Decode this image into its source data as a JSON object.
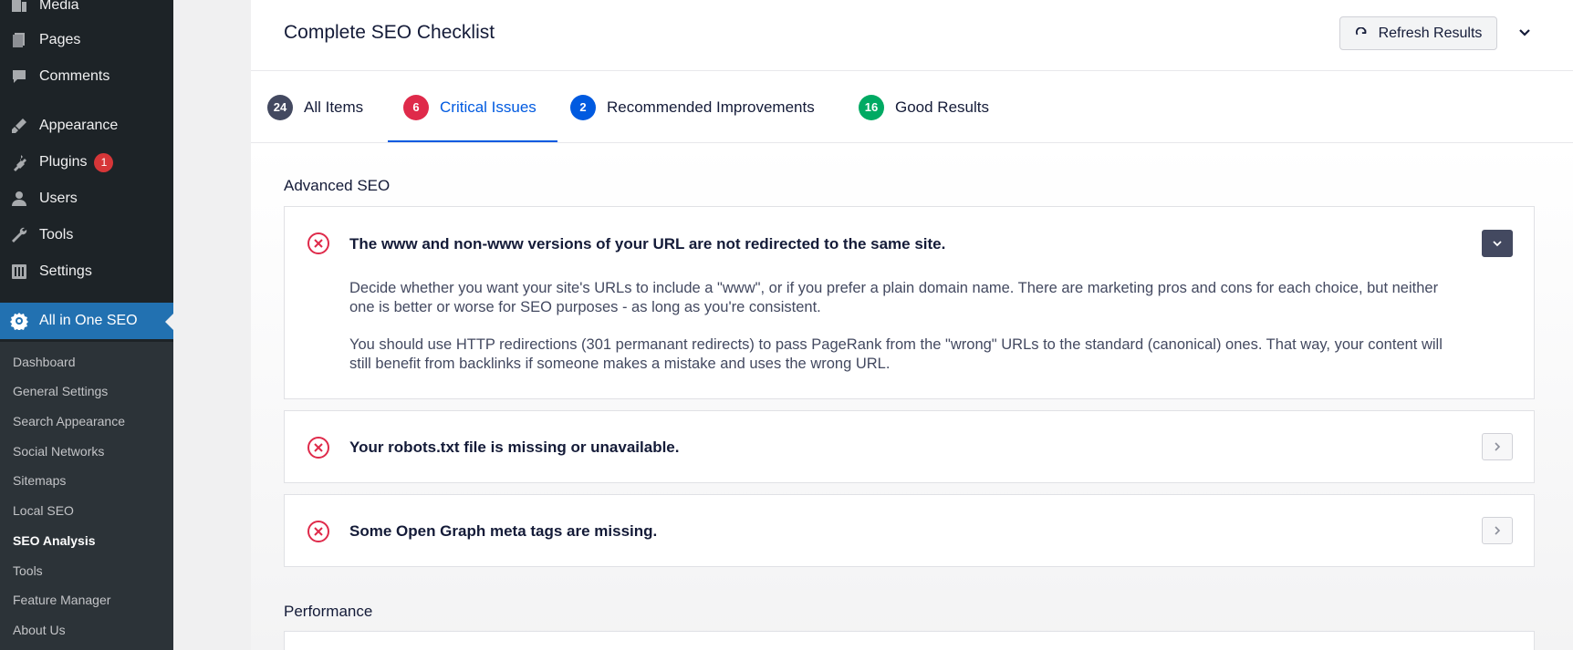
{
  "sidebar": {
    "menu": [
      {
        "label": "Media",
        "icon": "media-icon"
      },
      {
        "label": "Pages",
        "icon": "pages-icon"
      },
      {
        "label": "Comments",
        "icon": "comments-icon"
      },
      {
        "label": "Appearance",
        "icon": "appearance-icon"
      },
      {
        "label": "Plugins",
        "icon": "plugins-icon",
        "badge": "1"
      },
      {
        "label": "Users",
        "icon": "users-icon"
      },
      {
        "label": "Tools",
        "icon": "tools-icon"
      },
      {
        "label": "Settings",
        "icon": "settings-icon"
      },
      {
        "label": "All in One SEO",
        "icon": "aioseo-gear-icon"
      }
    ],
    "submenu": [
      "Dashboard",
      "General Settings",
      "Search Appearance",
      "Social Networks",
      "Sitemaps",
      "Local SEO",
      "SEO Analysis",
      "Tools",
      "Feature Manager",
      "About Us"
    ],
    "current_submenu": "SEO Analysis"
  },
  "header": {
    "title": "Complete SEO Checklist",
    "refresh_label": "Refresh Results"
  },
  "tabs": [
    {
      "count": "24",
      "label": "All Items",
      "color": "#434960"
    },
    {
      "count": "6",
      "label": "Critical Issues",
      "color": "#df2a4a"
    },
    {
      "count": "2",
      "label": "Recommended Improvements",
      "color": "#005ae0"
    },
    {
      "count": "16",
      "label": "Good Results",
      "color": "#00aa63"
    }
  ],
  "sections": {
    "advanced_title": "Advanced SEO",
    "performance_title": "Performance"
  },
  "issues": [
    {
      "title": "The www and non-www versions of your URL are not redirected to the same site.",
      "para1": "Decide whether you want your site's URLs to include a \"www\", or if you prefer a plain domain name. There are marketing pros and cons for each choice, but neither one is better or worse for SEO purposes - as long as you're consistent.",
      "para2": "You should use HTTP redirections (301 permanant redirects) to pass PageRank from the \"wrong\" URLs to the standard (canonical) ones. That way, your content will still benefit from backlinks if someone makes a mistake and uses the wrong URL."
    },
    {
      "title": "Your robots.txt file is missing or unavailable."
    },
    {
      "title": "Some Open Graph meta tags are missing."
    }
  ],
  "colors": {
    "critical": "#df2a4a",
    "accent": "#005ae0",
    "sidebar_bg": "#1d2327",
    "active_menu": "#2271b1"
  }
}
